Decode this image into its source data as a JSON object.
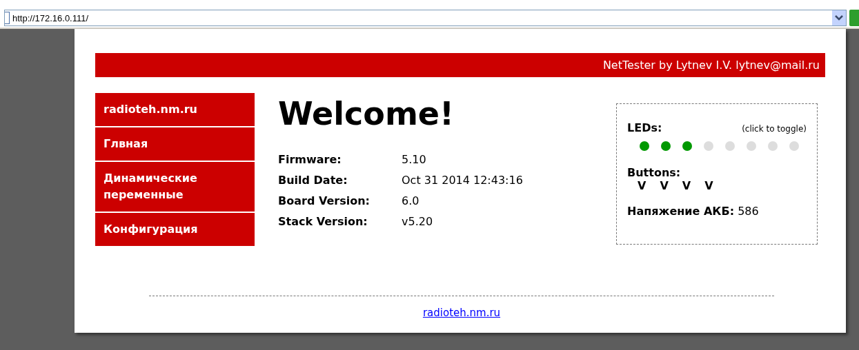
{
  "address_bar": {
    "url": "http://172.16.0.111/"
  },
  "header": {
    "title": "NetTester by Lytnev I.V. lytnev@mail.ru"
  },
  "sidebar": {
    "items": [
      {
        "label": "radioteh.nm.ru"
      },
      {
        "label": "Глвная"
      },
      {
        "label": "Динамические переменные"
      },
      {
        "label": "Конфигурация"
      }
    ]
  },
  "main": {
    "heading": "Welcome!",
    "info": [
      {
        "label": "Firmware:",
        "value": "5.10"
      },
      {
        "label": "Build Date:",
        "value": "Oct 31 2014 12:43:16"
      },
      {
        "label": "Board Version:",
        "value": "6.0"
      },
      {
        "label": "Stack Version:",
        "value": "v5.20"
      }
    ]
  },
  "status": {
    "leds_label": "LEDs:",
    "leds_hint": "(click to toggle)",
    "leds": [
      {
        "on": true
      },
      {
        "on": true
      },
      {
        "on": true
      },
      {
        "on": false
      },
      {
        "on": false
      },
      {
        "on": false
      },
      {
        "on": false
      },
      {
        "on": false
      }
    ],
    "buttons_label": "Buttons:",
    "buttons": [
      "V",
      "V",
      "V",
      "V"
    ],
    "voltage_label": "Напяжение АКБ:",
    "voltage_value": "586"
  },
  "footer": {
    "link": "radioteh.nm.ru"
  }
}
